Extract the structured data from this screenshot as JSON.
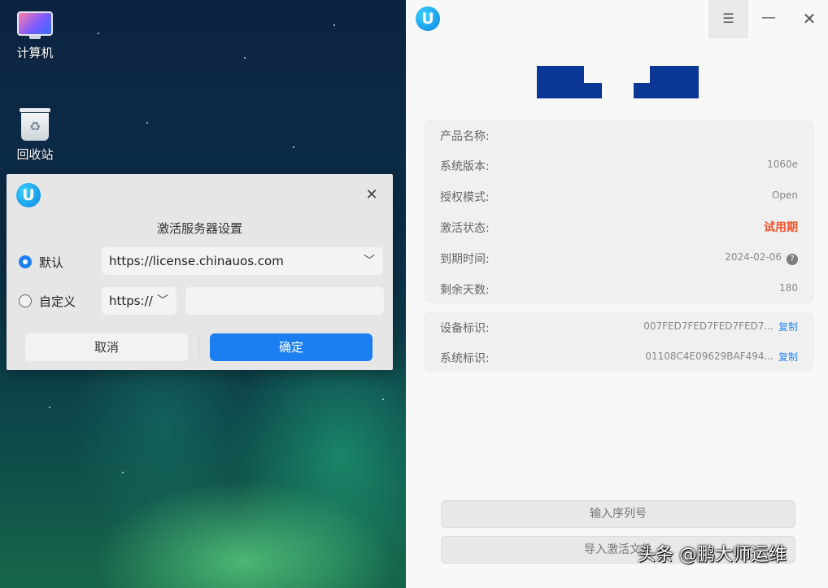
{
  "desktop": {
    "icons": [
      {
        "label": "计算机",
        "icon": "computer-icon"
      },
      {
        "label": "回收站",
        "icon": "trash-icon"
      }
    ]
  },
  "server_dialog": {
    "title": "激活服务器设置",
    "default_label": "默认",
    "default_url": "https://license.chinauos.com",
    "custom_label": "自定义",
    "protocol": "https://",
    "custom_value": "",
    "cancel_label": "取消",
    "confirm_label": "确定",
    "selected": "default",
    "accent": "#1c7ff1"
  },
  "license_window": {
    "info": [
      {
        "key": "产品名称:",
        "value": ""
      },
      {
        "key": "系统版本:",
        "value": "1060e"
      },
      {
        "key": "授权模式:",
        "value": "Open"
      },
      {
        "key": "激活状态:",
        "value": "试用期"
      },
      {
        "key": "到期时间:",
        "value": "2024-02-06"
      },
      {
        "key": "剩余天数:",
        "value": "180"
      }
    ],
    "ids": [
      {
        "key": "设备标识:",
        "value": "007FED7FED7FED7FED7...",
        "action": "复制"
      },
      {
        "key": "系统标识:",
        "value": "01108C4E09629BAF494...",
        "action": "复制"
      }
    ],
    "enter_serial_label": "输入序列号",
    "import_file_label": "导入激活文件",
    "status_color": "#f2542d",
    "logo_color": "#0a3795"
  },
  "watermark": "头条 @鹏大师运维"
}
